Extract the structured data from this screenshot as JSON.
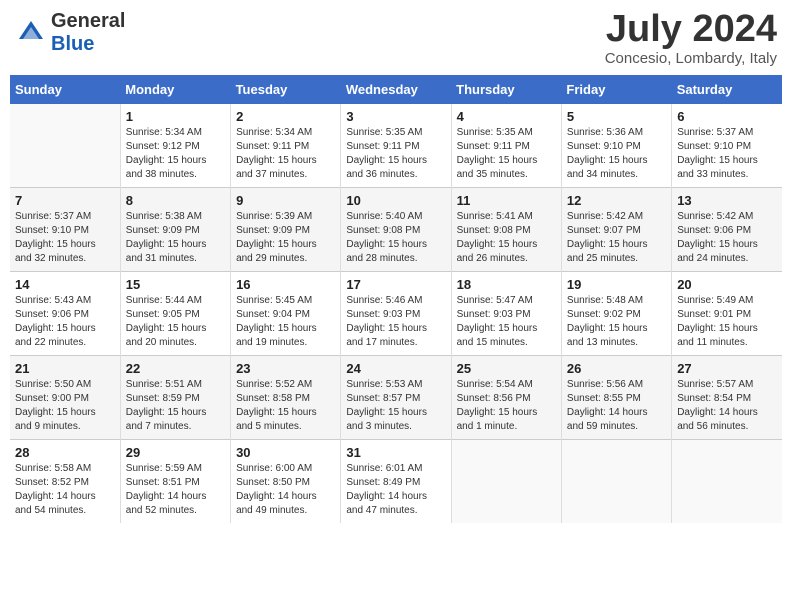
{
  "header": {
    "logo_line1": "General",
    "logo_line2": "Blue",
    "month": "July 2024",
    "location": "Concesio, Lombardy, Italy"
  },
  "weekdays": [
    "Sunday",
    "Monday",
    "Tuesday",
    "Wednesday",
    "Thursday",
    "Friday",
    "Saturday"
  ],
  "weeks": [
    [
      {
        "day": "",
        "info": ""
      },
      {
        "day": "1",
        "info": "Sunrise: 5:34 AM\nSunset: 9:12 PM\nDaylight: 15 hours\nand 38 minutes."
      },
      {
        "day": "2",
        "info": "Sunrise: 5:34 AM\nSunset: 9:11 PM\nDaylight: 15 hours\nand 37 minutes."
      },
      {
        "day": "3",
        "info": "Sunrise: 5:35 AM\nSunset: 9:11 PM\nDaylight: 15 hours\nand 36 minutes."
      },
      {
        "day": "4",
        "info": "Sunrise: 5:35 AM\nSunset: 9:11 PM\nDaylight: 15 hours\nand 35 minutes."
      },
      {
        "day": "5",
        "info": "Sunrise: 5:36 AM\nSunset: 9:10 PM\nDaylight: 15 hours\nand 34 minutes."
      },
      {
        "day": "6",
        "info": "Sunrise: 5:37 AM\nSunset: 9:10 PM\nDaylight: 15 hours\nand 33 minutes."
      }
    ],
    [
      {
        "day": "7",
        "info": "Sunrise: 5:37 AM\nSunset: 9:10 PM\nDaylight: 15 hours\nand 32 minutes."
      },
      {
        "day": "8",
        "info": "Sunrise: 5:38 AM\nSunset: 9:09 PM\nDaylight: 15 hours\nand 31 minutes."
      },
      {
        "day": "9",
        "info": "Sunrise: 5:39 AM\nSunset: 9:09 PM\nDaylight: 15 hours\nand 29 minutes."
      },
      {
        "day": "10",
        "info": "Sunrise: 5:40 AM\nSunset: 9:08 PM\nDaylight: 15 hours\nand 28 minutes."
      },
      {
        "day": "11",
        "info": "Sunrise: 5:41 AM\nSunset: 9:08 PM\nDaylight: 15 hours\nand 26 minutes."
      },
      {
        "day": "12",
        "info": "Sunrise: 5:42 AM\nSunset: 9:07 PM\nDaylight: 15 hours\nand 25 minutes."
      },
      {
        "day": "13",
        "info": "Sunrise: 5:42 AM\nSunset: 9:06 PM\nDaylight: 15 hours\nand 24 minutes."
      }
    ],
    [
      {
        "day": "14",
        "info": "Sunrise: 5:43 AM\nSunset: 9:06 PM\nDaylight: 15 hours\nand 22 minutes."
      },
      {
        "day": "15",
        "info": "Sunrise: 5:44 AM\nSunset: 9:05 PM\nDaylight: 15 hours\nand 20 minutes."
      },
      {
        "day": "16",
        "info": "Sunrise: 5:45 AM\nSunset: 9:04 PM\nDaylight: 15 hours\nand 19 minutes."
      },
      {
        "day": "17",
        "info": "Sunrise: 5:46 AM\nSunset: 9:03 PM\nDaylight: 15 hours\nand 17 minutes."
      },
      {
        "day": "18",
        "info": "Sunrise: 5:47 AM\nSunset: 9:03 PM\nDaylight: 15 hours\nand 15 minutes."
      },
      {
        "day": "19",
        "info": "Sunrise: 5:48 AM\nSunset: 9:02 PM\nDaylight: 15 hours\nand 13 minutes."
      },
      {
        "day": "20",
        "info": "Sunrise: 5:49 AM\nSunset: 9:01 PM\nDaylight: 15 hours\nand 11 minutes."
      }
    ],
    [
      {
        "day": "21",
        "info": "Sunrise: 5:50 AM\nSunset: 9:00 PM\nDaylight: 15 hours\nand 9 minutes."
      },
      {
        "day": "22",
        "info": "Sunrise: 5:51 AM\nSunset: 8:59 PM\nDaylight: 15 hours\nand 7 minutes."
      },
      {
        "day": "23",
        "info": "Sunrise: 5:52 AM\nSunset: 8:58 PM\nDaylight: 15 hours\nand 5 minutes."
      },
      {
        "day": "24",
        "info": "Sunrise: 5:53 AM\nSunset: 8:57 PM\nDaylight: 15 hours\nand 3 minutes."
      },
      {
        "day": "25",
        "info": "Sunrise: 5:54 AM\nSunset: 8:56 PM\nDaylight: 15 hours\nand 1 minute."
      },
      {
        "day": "26",
        "info": "Sunrise: 5:56 AM\nSunset: 8:55 PM\nDaylight: 14 hours\nand 59 minutes."
      },
      {
        "day": "27",
        "info": "Sunrise: 5:57 AM\nSunset: 8:54 PM\nDaylight: 14 hours\nand 56 minutes."
      }
    ],
    [
      {
        "day": "28",
        "info": "Sunrise: 5:58 AM\nSunset: 8:52 PM\nDaylight: 14 hours\nand 54 minutes."
      },
      {
        "day": "29",
        "info": "Sunrise: 5:59 AM\nSunset: 8:51 PM\nDaylight: 14 hours\nand 52 minutes."
      },
      {
        "day": "30",
        "info": "Sunrise: 6:00 AM\nSunset: 8:50 PM\nDaylight: 14 hours\nand 49 minutes."
      },
      {
        "day": "31",
        "info": "Sunrise: 6:01 AM\nSunset: 8:49 PM\nDaylight: 14 hours\nand 47 minutes."
      },
      {
        "day": "",
        "info": ""
      },
      {
        "day": "",
        "info": ""
      },
      {
        "day": "",
        "info": ""
      }
    ]
  ]
}
